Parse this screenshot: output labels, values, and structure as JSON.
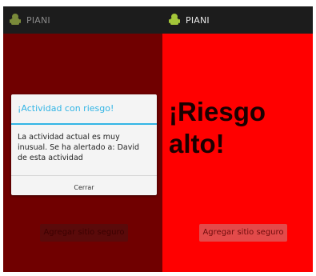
{
  "colors": {
    "actionbar": "#1c1c1c",
    "left_background": "#700000",
    "right_background": "#ff0000",
    "dialog_accent": "#33b5e5"
  },
  "left_screen": {
    "app_title": "PIANI",
    "app_icon": "android-icon",
    "dialog": {
      "title": "¡Actividad con riesgo!",
      "message": "La actividad actual es muy inusual. Se ha alertado a: David de esta actividad",
      "button": "Cerrar"
    },
    "safe_button": "Agregar sitio seguro"
  },
  "right_screen": {
    "app_title": "PIANI",
    "app_icon": "android-icon",
    "alert_line1": "¡Riesgo",
    "alert_line2": "alto!",
    "safe_button": "Agregar sitio seguro"
  }
}
